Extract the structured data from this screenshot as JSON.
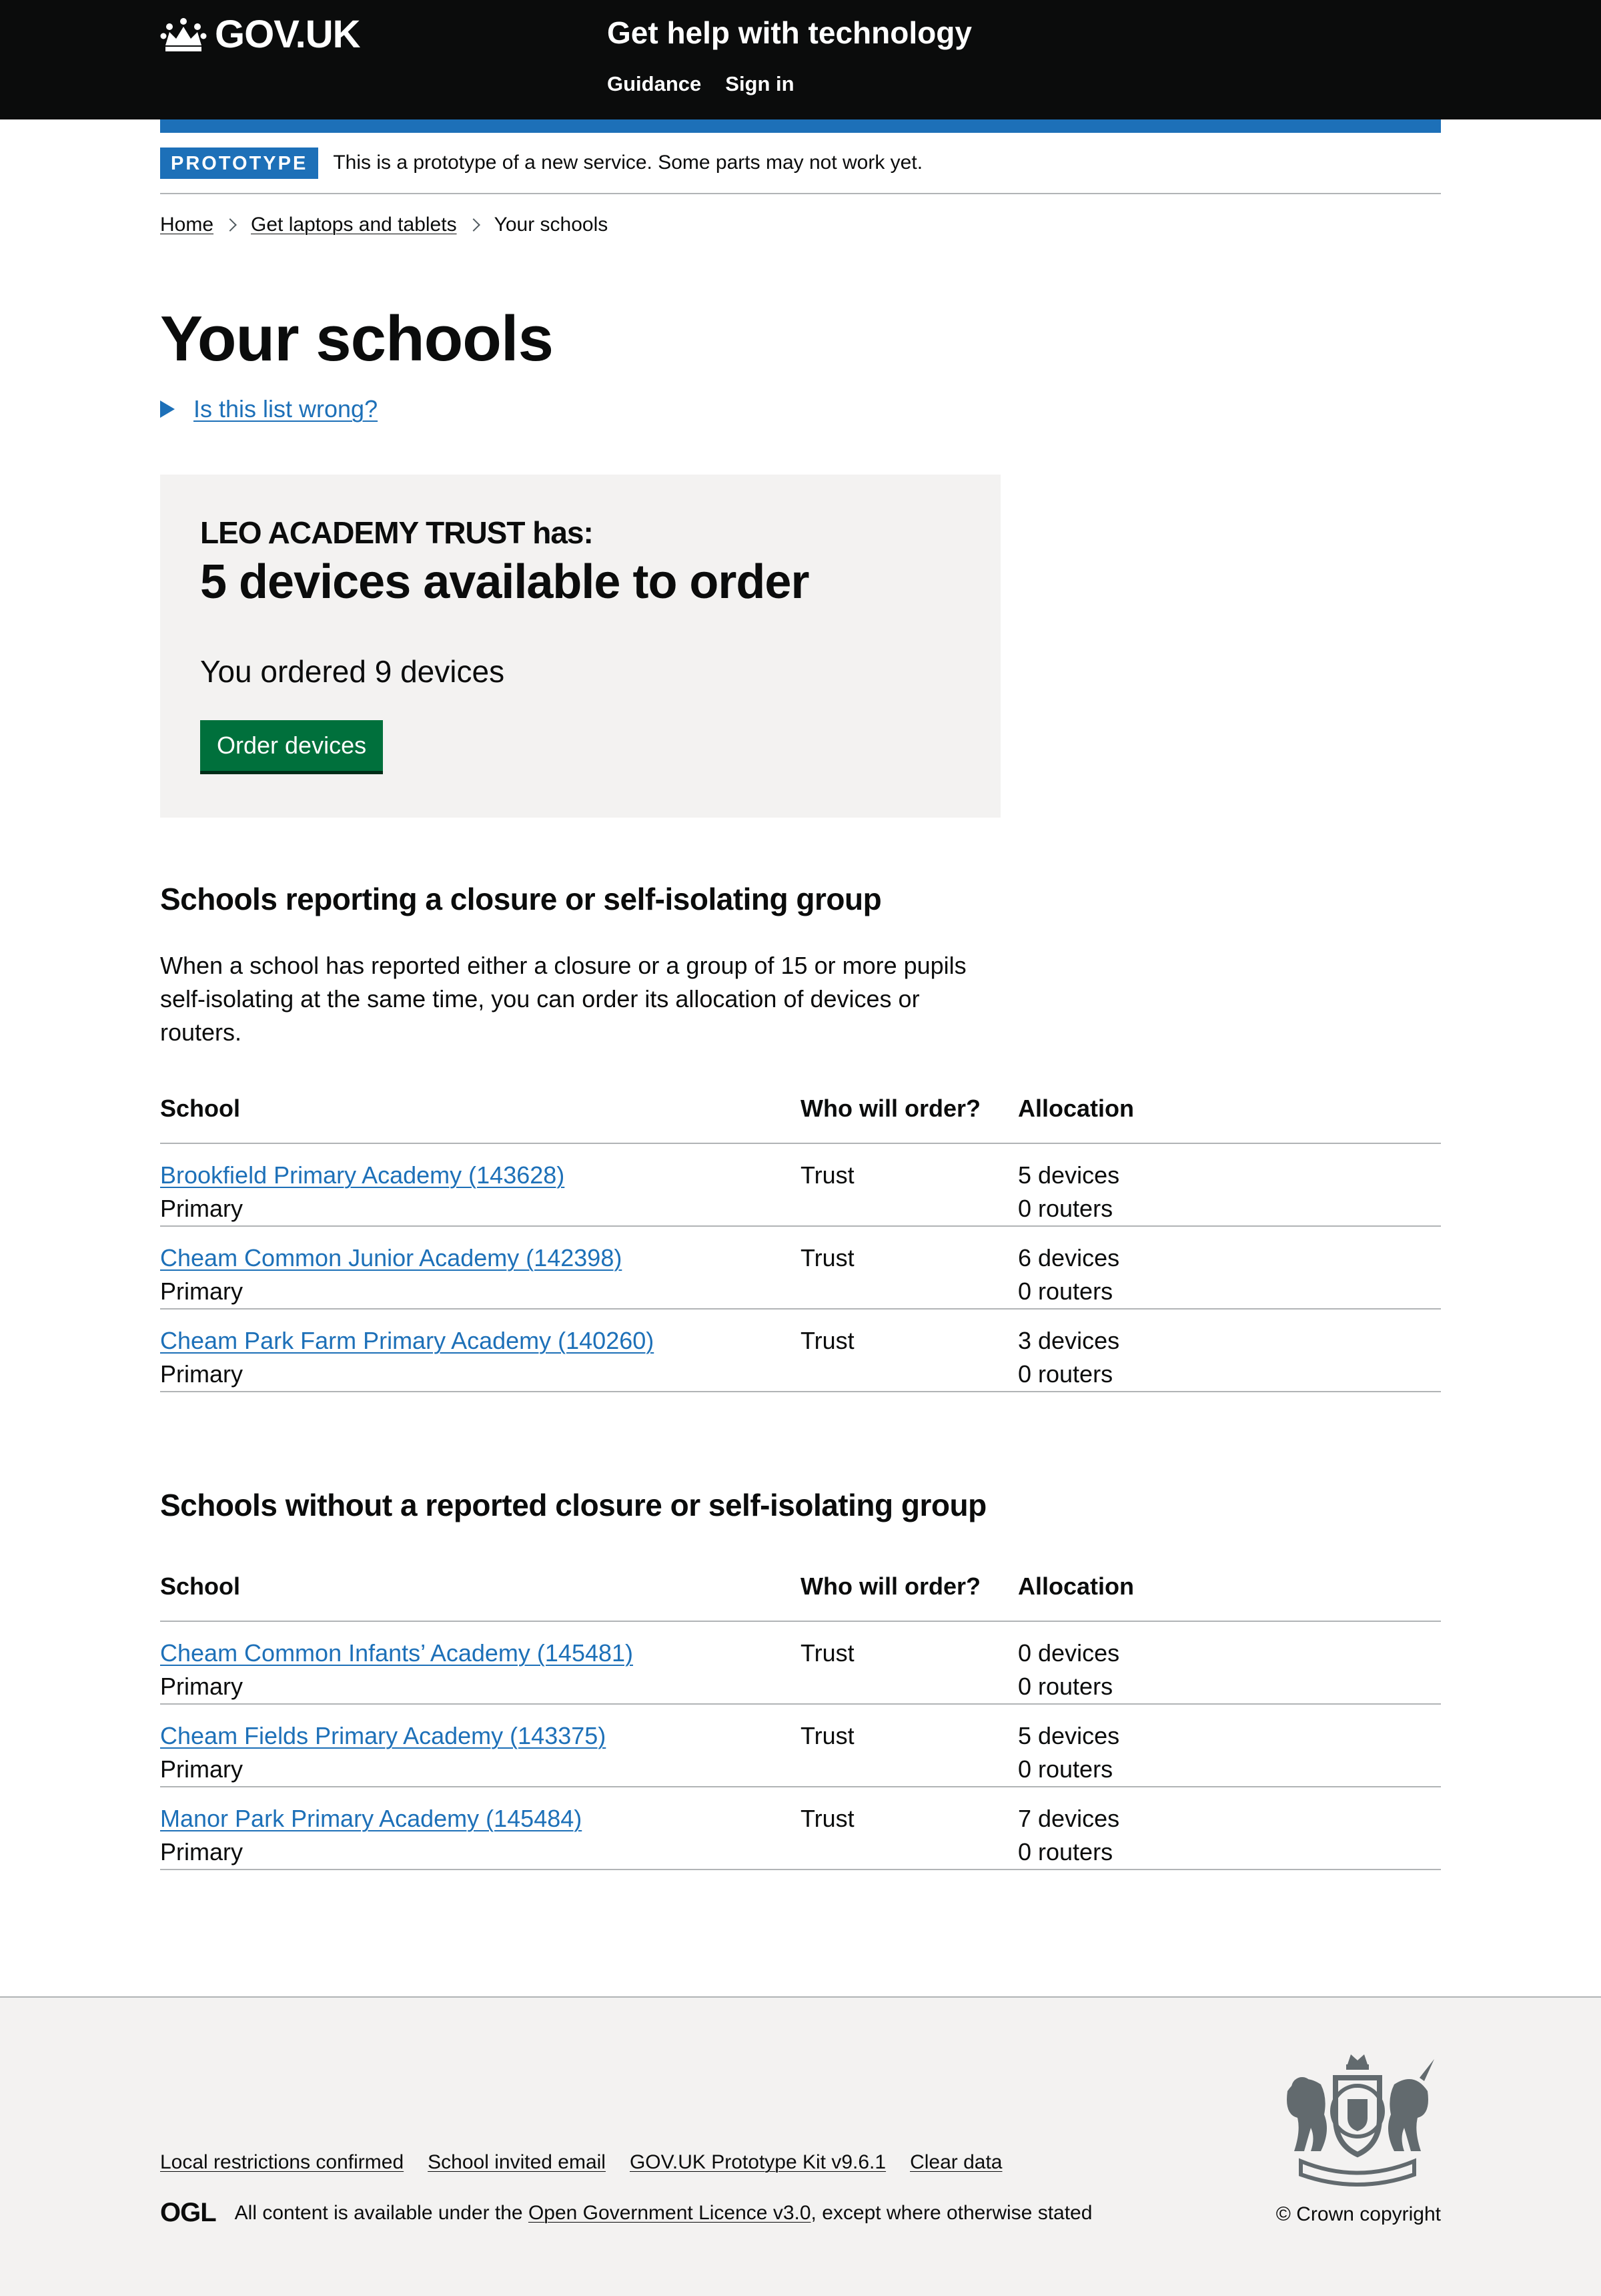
{
  "header": {
    "logo_text": "GOV.UK",
    "service_name": "Get help with technology",
    "nav": [
      "Guidance",
      "Sign in"
    ]
  },
  "phase_banner": {
    "tag": "PROTOTYPE",
    "text": "This is a prototype of a new service. Some parts may not work yet."
  },
  "breadcrumbs": [
    "Home",
    "Get laptops and tablets",
    "Your schools"
  ],
  "page_title": "Your schools",
  "details_summary": "Is this list wrong?",
  "panel": {
    "trust_line": "LEO ACADEMY TRUST has:",
    "available_line": "5 devices available to order",
    "ordered_line": "You ordered 9 devices",
    "button_label": "Order devices"
  },
  "section_closure": {
    "heading": "Schools reporting a closure or self-isolating group",
    "body": "When a school has reported either a closure or a group of 15 or more pupils self-isolating at the same time, you can order its allocation of devices or routers.",
    "columns": [
      "School",
      "Who will order?",
      "Allocation"
    ],
    "rows": [
      {
        "school": "Brookfield Primary Academy (143628)",
        "phase": "Primary",
        "who": "Trust",
        "devices": "5 devices",
        "routers": "0 routers"
      },
      {
        "school": "Cheam Common Junior Academy (142398)",
        "phase": "Primary",
        "who": "Trust",
        "devices": "6 devices",
        "routers": "0 routers"
      },
      {
        "school": "Cheam Park Farm Primary Academy (140260)",
        "phase": "Primary",
        "who": "Trust",
        "devices": "3 devices",
        "routers": "0 routers"
      }
    ]
  },
  "section_no_closure": {
    "heading": "Schools without a reported closure or self-isolating group",
    "columns": [
      "School",
      "Who will order?",
      "Allocation"
    ],
    "rows": [
      {
        "school": "Cheam Common Infants’ Academy (145481)",
        "phase": "Primary",
        "who": "Trust",
        "devices": "0 devices",
        "routers": "0 routers"
      },
      {
        "school": "Cheam Fields Primary Academy (143375)",
        "phase": "Primary",
        "who": "Trust",
        "devices": "5 devices",
        "routers": "0 routers"
      },
      {
        "school": "Manor Park Primary Academy (145484)",
        "phase": "Primary",
        "who": "Trust",
        "devices": "7 devices",
        "routers": "0 routers"
      }
    ]
  },
  "footer": {
    "links": [
      "Local restrictions confirmed",
      "School invited email",
      "GOV.UK Prototype Kit v9.6.1",
      "Clear data"
    ],
    "ogl_mark": "OGL",
    "licence_prefix": "All content is available under the ",
    "licence_link": "Open Government Licence v3.0",
    "licence_suffix": ", except where otherwise stated",
    "copyright": "© Crown copyright"
  },
  "colors": {
    "header_bg": "#0b0c0c",
    "accent_blue": "#1d70b8",
    "button_green": "#00703c",
    "panel_bg": "#f3f2f1"
  }
}
